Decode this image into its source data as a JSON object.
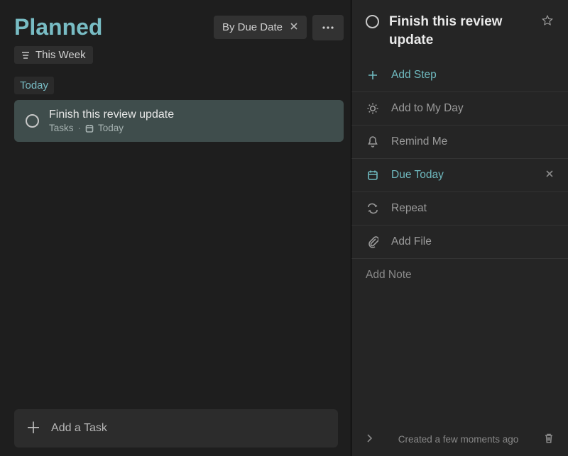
{
  "header": {
    "title": "Planned",
    "sort_label": "By Due Date",
    "filter_label": "This Week"
  },
  "group": {
    "label": "Today"
  },
  "task": {
    "title": "Finish this review update",
    "list": "Tasks",
    "due_label": "Today"
  },
  "add_task": {
    "placeholder": "Add a Task"
  },
  "detail": {
    "title": "Finish this review update",
    "add_step": "Add Step",
    "my_day": "Add to My Day",
    "remind": "Remind Me",
    "due": "Due Today",
    "repeat": "Repeat",
    "add_file": "Add File",
    "note_placeholder": "Add Note",
    "footer_text": "Created a few moments ago"
  },
  "colors": {
    "accent": "#78bcc4"
  }
}
